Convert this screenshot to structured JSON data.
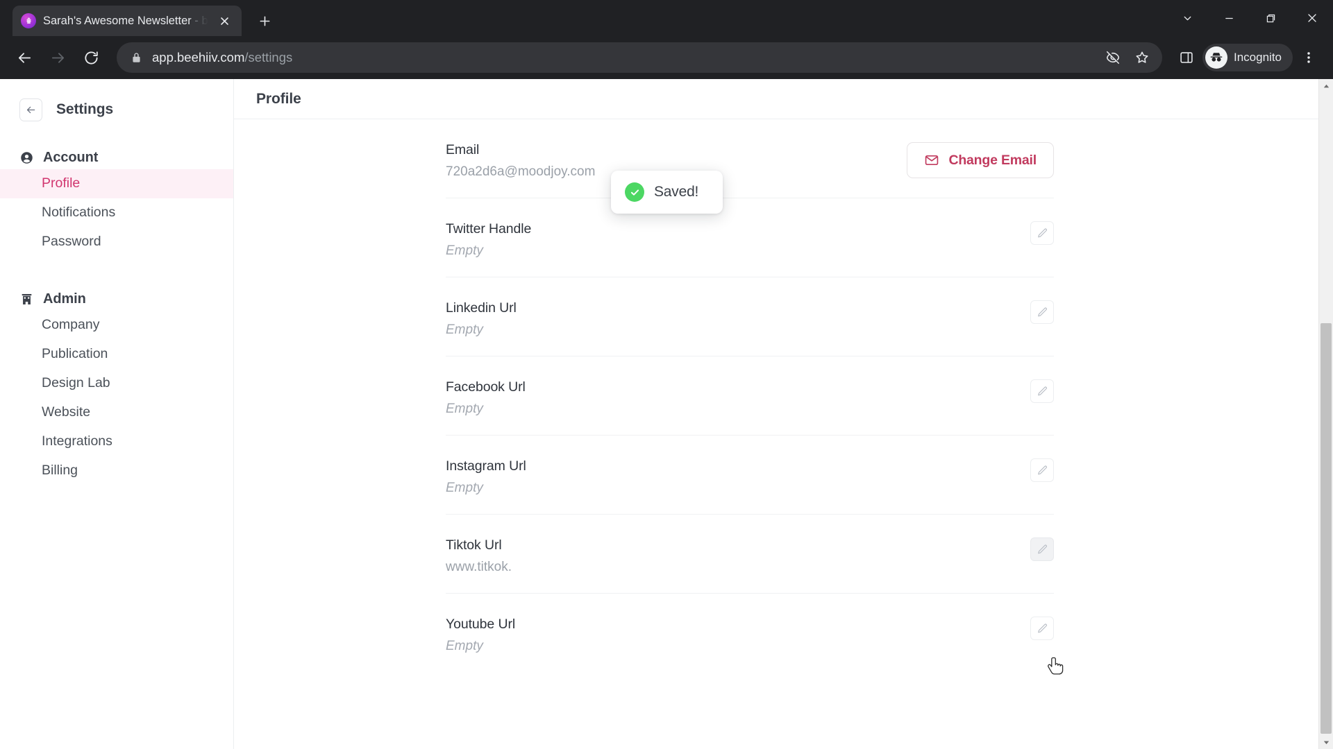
{
  "browser": {
    "tab": {
      "title_main": "Sarah's Awesome Newsletter",
      "title_dim": " - b",
      "favicon_name": "beehiiv-favicon",
      "close_label": "✕"
    },
    "newtab_label": "+",
    "window_controls": {
      "tab_search": "tab-search-chevron",
      "minimize": "minimize",
      "restore": "restore",
      "close": "close"
    },
    "toolbar": {
      "back": "back",
      "forward": "forward",
      "reload": "reload",
      "url_domain": "app.beehiiv.com",
      "url_path": "/settings",
      "lock_icon": "lock-icon",
      "tracking_icon": "eye-off-icon",
      "bookmark_icon": "star-icon",
      "sidepanel_icon": "side-panel-icon",
      "profile_label": "Incognito",
      "menu_icon": "three-dot-menu-icon"
    }
  },
  "sidebar": {
    "title": "Settings",
    "back_button": "back-arrow",
    "groups": [
      {
        "label": "Account",
        "icon": "user-circle-icon",
        "items": [
          {
            "label": "Profile",
            "active": true
          },
          {
            "label": "Notifications",
            "active": false
          },
          {
            "label": "Password",
            "active": false
          }
        ]
      },
      {
        "label": "Admin",
        "icon": "building-icon",
        "items": [
          {
            "label": "Company",
            "active": false
          },
          {
            "label": "Publication",
            "active": false
          },
          {
            "label": "Design Lab",
            "active": false
          },
          {
            "label": "Website",
            "active": false
          },
          {
            "label": "Integrations",
            "active": false
          },
          {
            "label": "Billing",
            "active": false
          }
        ]
      }
    ]
  },
  "page": {
    "title": "Profile",
    "toast": {
      "message": "Saved!",
      "icon": "check-circle-icon",
      "icon_color": "#4cd763"
    },
    "fields": [
      {
        "label": "Email",
        "value": "720a2d6a@moodjoy.com",
        "empty": false,
        "action": "change-email",
        "action_label": "Change Email"
      },
      {
        "label": "Twitter Handle",
        "value": "Empty",
        "empty": true,
        "action": "edit"
      },
      {
        "label": "Linkedin Url",
        "value": "Empty",
        "empty": true,
        "action": "edit"
      },
      {
        "label": "Facebook Url",
        "value": "Empty",
        "empty": true,
        "action": "edit"
      },
      {
        "label": "Instagram Url",
        "value": "Empty",
        "empty": true,
        "action": "edit"
      },
      {
        "label": "Tiktok Url",
        "value": "www.titkok.",
        "empty": false,
        "action": "edit",
        "hovered": true
      },
      {
        "label": "Youtube Url",
        "value": "Empty",
        "empty": true,
        "action": "edit"
      }
    ]
  },
  "colors": {
    "accent_pink": "#d1366f",
    "accent_pink_bg": "#fdf0f6",
    "button_red": "#c13a5e",
    "toast_green": "#4cd763",
    "chrome_dark": "#202124"
  }
}
